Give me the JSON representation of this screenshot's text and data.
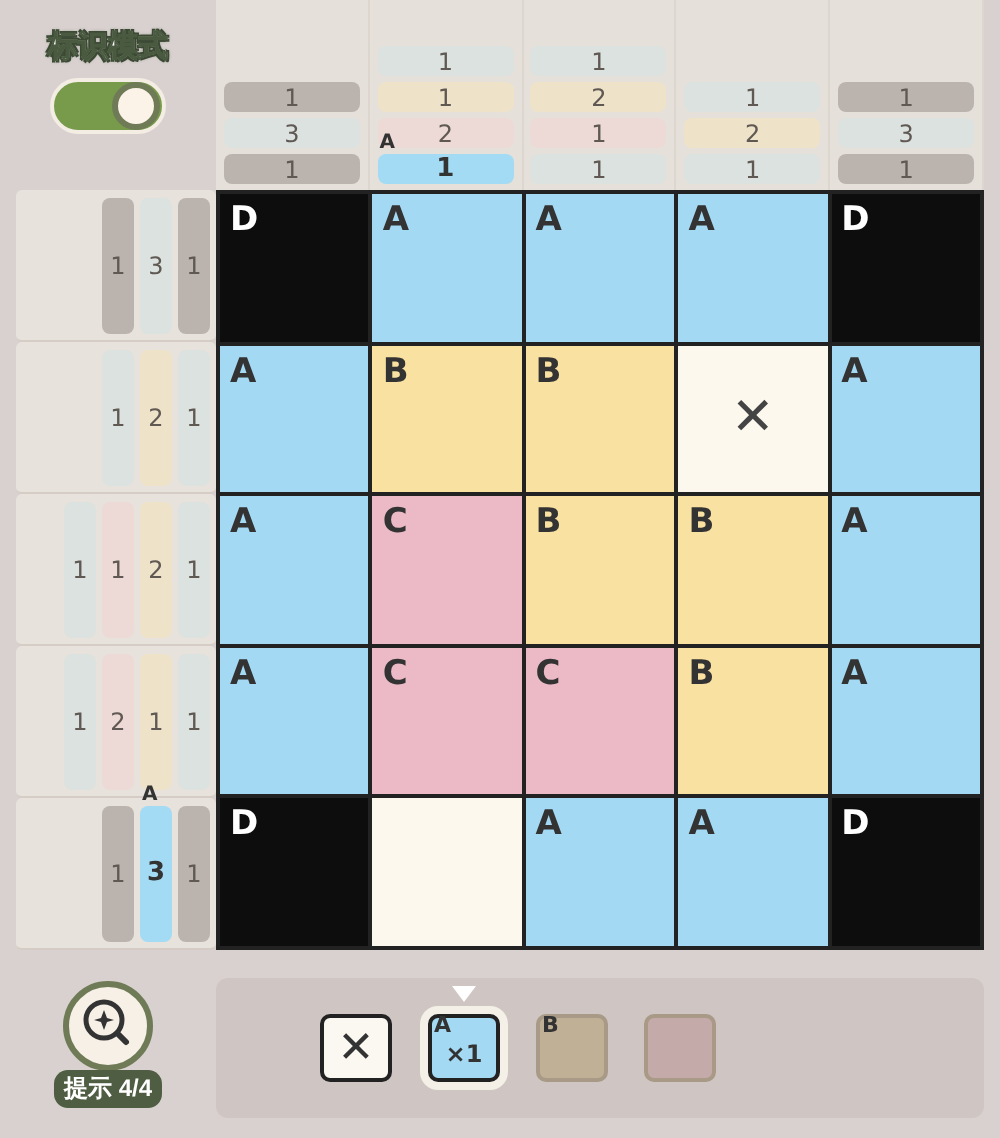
{
  "mode_toggle": {
    "label": "标识模式",
    "on": true
  },
  "column_clues": [
    {
      "chips": [
        {
          "value": "1",
          "color": "#bbb4ae",
          "selected": false
        },
        {
          "value": "3",
          "color": "#dbe2e0",
          "selected": false
        },
        {
          "value": "1",
          "color": "#bbb4ae",
          "selected": false
        }
      ]
    },
    {
      "chips": [
        {
          "value": "1",
          "color": "#dbe2e0",
          "selected": false
        },
        {
          "value": "1",
          "color": "#eee2c8",
          "selected": false
        },
        {
          "value": "2",
          "color": "#eddad6",
          "selected": false
        },
        {
          "value": "1",
          "color": "#a3dbf5",
          "selected": true,
          "tag": "A"
        }
      ]
    },
    {
      "chips": [
        {
          "value": "1",
          "color": "#dbe2e0",
          "selected": false
        },
        {
          "value": "2",
          "color": "#eee2c8",
          "selected": false
        },
        {
          "value": "1",
          "color": "#eddad6",
          "selected": false
        },
        {
          "value": "1",
          "color": "#dbe2e0",
          "selected": false
        }
      ]
    },
    {
      "chips": [
        {
          "value": "1",
          "color": "#dbe2e0",
          "selected": false
        },
        {
          "value": "2",
          "color": "#eee2c8",
          "selected": false
        },
        {
          "value": "1",
          "color": "#dbe2e0",
          "selected": false
        }
      ]
    },
    {
      "chips": [
        {
          "value": "1",
          "color": "#bbb4ae",
          "selected": false
        },
        {
          "value": "3",
          "color": "#dbe2e0",
          "selected": false
        },
        {
          "value": "1",
          "color": "#bbb4ae",
          "selected": false
        }
      ]
    }
  ],
  "row_clues": [
    {
      "chips": [
        {
          "value": "1",
          "color": "#bbb4ae",
          "selected": false
        },
        {
          "value": "3",
          "color": "#dbe2e0",
          "selected": false
        },
        {
          "value": "1",
          "color": "#bbb4ae",
          "selected": false
        }
      ]
    },
    {
      "chips": [
        {
          "value": "1",
          "color": "#dbe2e0",
          "selected": false
        },
        {
          "value": "2",
          "color": "#eee2c8",
          "selected": false
        },
        {
          "value": "1",
          "color": "#dbe2e0",
          "selected": false
        }
      ]
    },
    {
      "chips": [
        {
          "value": "1",
          "color": "#dbe2e0",
          "selected": false
        },
        {
          "value": "1",
          "color": "#eddad6",
          "selected": false
        },
        {
          "value": "2",
          "color": "#eee2c8",
          "selected": false
        },
        {
          "value": "1",
          "color": "#dbe2e0",
          "selected": false
        }
      ]
    },
    {
      "chips": [
        {
          "value": "1",
          "color": "#dbe2e0",
          "selected": false
        },
        {
          "value": "2",
          "color": "#eddad6",
          "selected": false
        },
        {
          "value": "1",
          "color": "#eee2c8",
          "selected": false
        },
        {
          "value": "1",
          "color": "#dbe2e0",
          "selected": false
        }
      ]
    },
    {
      "chips": [
        {
          "value": "1",
          "color": "#bbb4ae",
          "selected": false
        },
        {
          "value": "3",
          "color": "#a3dbf5",
          "selected": true,
          "tag": "A"
        },
        {
          "value": "1",
          "color": "#bbb4ae",
          "selected": false
        }
      ]
    }
  ],
  "grid": [
    [
      {
        "kind": "fill",
        "label": "D",
        "color": "#0d0d0d"
      },
      {
        "kind": "fill",
        "label": "A",
        "color": "#a3d9f3"
      },
      {
        "kind": "fill",
        "label": "A",
        "color": "#a3d9f3"
      },
      {
        "kind": "fill",
        "label": "A",
        "color": "#a3d9f3"
      },
      {
        "kind": "fill",
        "label": "D",
        "color": "#0d0d0d"
      }
    ],
    [
      {
        "kind": "fill",
        "label": "A",
        "color": "#a3d9f3"
      },
      {
        "kind": "fill",
        "label": "B",
        "color": "#f9e1a2"
      },
      {
        "kind": "fill",
        "label": "B",
        "color": "#f9e1a2"
      },
      {
        "kind": "cross",
        "label": "✕"
      },
      {
        "kind": "fill",
        "label": "A",
        "color": "#a3d9f3"
      }
    ],
    [
      {
        "kind": "fill",
        "label": "A",
        "color": "#a3d9f3"
      },
      {
        "kind": "fill",
        "label": "C",
        "color": "#ebbac6"
      },
      {
        "kind": "fill",
        "label": "B",
        "color": "#f9e1a2"
      },
      {
        "kind": "fill",
        "label": "B",
        "color": "#f9e1a2"
      },
      {
        "kind": "fill",
        "label": "A",
        "color": "#a3d9f3"
      }
    ],
    [
      {
        "kind": "fill",
        "label": "A",
        "color": "#a3d9f3"
      },
      {
        "kind": "fill",
        "label": "C",
        "color": "#ebbac6"
      },
      {
        "kind": "fill",
        "label": "C",
        "color": "#ebbac6"
      },
      {
        "kind": "fill",
        "label": "B",
        "color": "#f9e1a2"
      },
      {
        "kind": "fill",
        "label": "A",
        "color": "#a3d9f3"
      }
    ],
    [
      {
        "kind": "fill",
        "label": "D",
        "color": "#0d0d0d"
      },
      {
        "kind": "empty"
      },
      {
        "kind": "fill",
        "label": "A",
        "color": "#a3d9f3"
      },
      {
        "kind": "fill",
        "label": "A",
        "color": "#a3d9f3"
      },
      {
        "kind": "fill",
        "label": "D",
        "color": "#0d0d0d"
      }
    ]
  ],
  "hint_button": {
    "label": "提示 4/4"
  },
  "palette": [
    {
      "kind": "cross",
      "label": "✕",
      "selected": false
    },
    {
      "kind": "swatch",
      "tag": "A",
      "count": "×1",
      "color": "#a3d9f3",
      "selected": true
    },
    {
      "kind": "swatch",
      "tag": "B",
      "color": "#bfb096",
      "selected": false
    },
    {
      "kind": "swatch",
      "color": "#c4aaa8",
      "selected": false
    }
  ]
}
